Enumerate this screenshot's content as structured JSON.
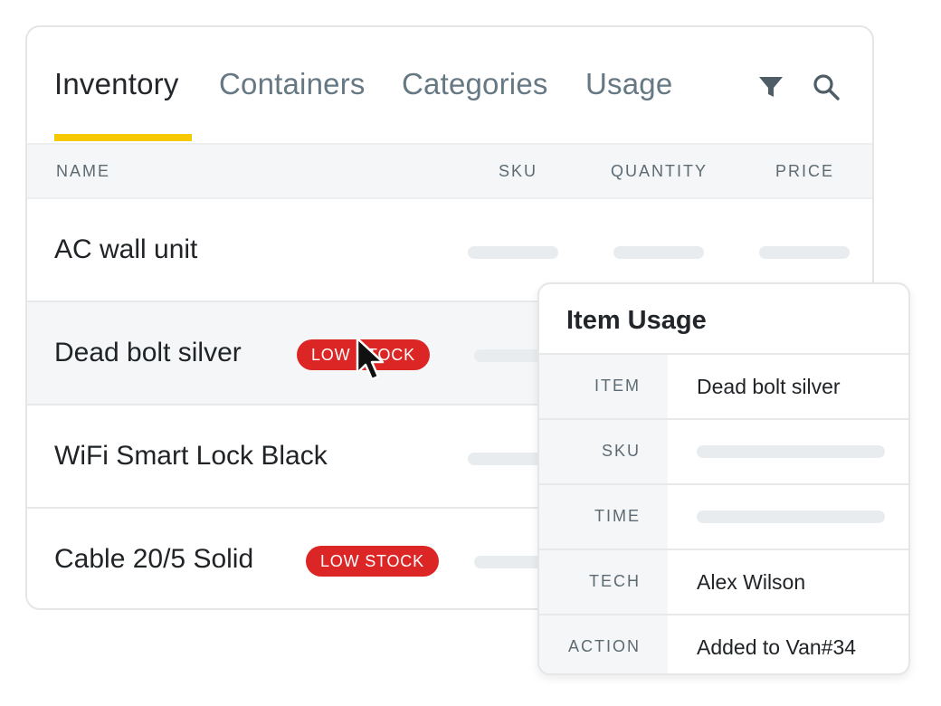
{
  "tabs": [
    {
      "label": "Inventory",
      "active": true
    },
    {
      "label": "Containers",
      "active": false
    },
    {
      "label": "Categories",
      "active": false
    },
    {
      "label": "Usage",
      "active": false
    }
  ],
  "toolbar": {
    "filter_icon": "filter-icon",
    "search_icon": "search-icon"
  },
  "table": {
    "columns": [
      "NAME",
      "SKU",
      "QUANTITY",
      "PRICE"
    ],
    "rows": [
      {
        "name": "AC wall unit",
        "badge": ""
      },
      {
        "name": "Dead bolt silver",
        "badge": "LOW STOCK"
      },
      {
        "name": "WiFi Smart Lock Black",
        "badge": ""
      },
      {
        "name": "Cable 20/5 Solid",
        "badge": "LOW STOCK"
      }
    ]
  },
  "popover": {
    "title": "Item Usage",
    "fields": [
      {
        "label": "ITEM",
        "value": "Dead bolt silver"
      },
      {
        "label": "SKU",
        "value": ""
      },
      {
        "label": "TIME",
        "value": ""
      },
      {
        "label": "TECH",
        "value": "Alex Wilson"
      },
      {
        "label": "ACTION",
        "value": "Added to Van#34"
      }
    ]
  },
  "colors": {
    "accent_underline": "#f5c800",
    "badge_red": "#dc2626",
    "tab_inactive": "#657883",
    "text_primary": "#202427"
  }
}
